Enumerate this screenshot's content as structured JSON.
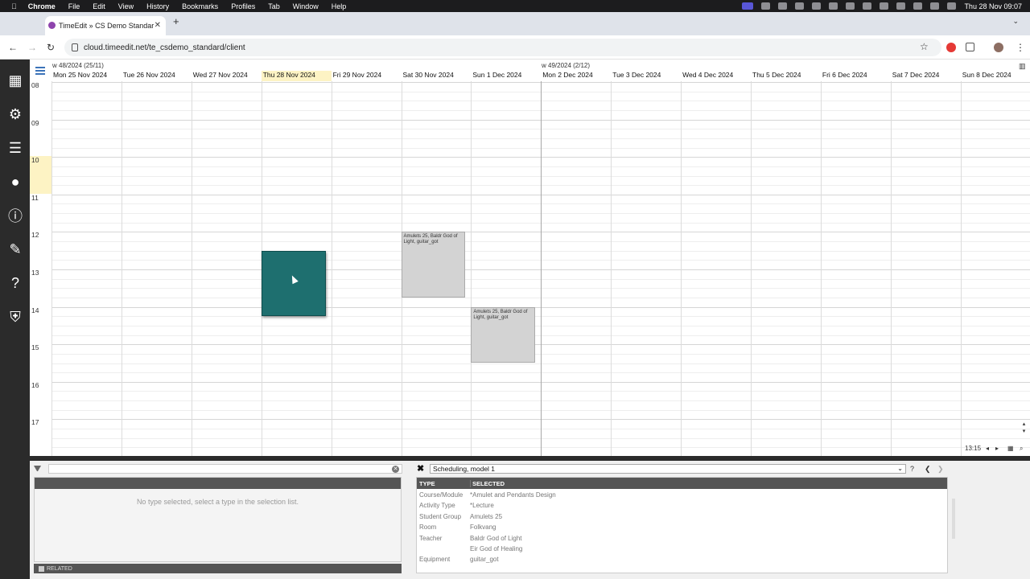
{
  "macos": {
    "app": "Chrome",
    "menus": [
      "File",
      "Edit",
      "View",
      "History",
      "Bookmarks",
      "Profiles",
      "Tab",
      "Window",
      "Help"
    ],
    "clock": "Thu 28 Nov  09:07"
  },
  "browser": {
    "tab_title": "TimeEdit » CS Demo Standar",
    "url": "cloud.timeedit.net/te_csdemo_standard/client"
  },
  "calendar": {
    "weeks": [
      {
        "label": "w 48/2024 (25/11)"
      },
      {
        "label": "w 49/2024 (2/12)"
      }
    ],
    "days": [
      "Mon 25 Nov 2024",
      "Tue 26 Nov 2024",
      "Wed 27 Nov 2024",
      "Thu 28 Nov 2024",
      "Fri 29 Nov 2024",
      "Sat 30 Nov 2024",
      "Sun 1 Dec 2024",
      "Mon 2 Dec 2024",
      "Tue 3 Dec 2024",
      "Wed 4 Dec 2024",
      "Thu 5 Dec 2024",
      "Fri 6 Dec 2024",
      "Sat 7 Dec 2024",
      "Sun 8 Dec 2024"
    ],
    "today_index": 3,
    "hours": [
      "08",
      "09",
      "10",
      "11",
      "12",
      "13",
      "14",
      "15",
      "16",
      "17"
    ],
    "current_hour": "10",
    "bookings": [
      {
        "text": "",
        "day": 3,
        "start": "12:30",
        "end": "14:15",
        "selected": true
      },
      {
        "text": "Amulets 25, Baldr God of Light, guitar_got",
        "day": 5,
        "start": "12:00",
        "end": "13:45",
        "selected": false
      },
      {
        "text": "Amulets 25, Baldr God of Light, guitar_got",
        "day": 6,
        "start": "14:00",
        "end": "15:30",
        "selected": false
      }
    ],
    "time_readout": "13:15"
  },
  "selection_panel": {
    "empty_message": "No type selected, select a type in the selection list.",
    "related_label": "RELATED"
  },
  "model_panel": {
    "model_select": "Scheduling, model 1",
    "col_type": "TYPE",
    "col_selected": "SELECTED",
    "rows": [
      {
        "type": "Course/Module",
        "value": "*Amulet and Pendants Design"
      },
      {
        "type": "Activity Type",
        "value": "*Lecture"
      },
      {
        "type": "Student Group",
        "value": "Amulets 25"
      },
      {
        "type": "Room",
        "value": "Folkvang"
      },
      {
        "type": "Teacher",
        "value": "Baldr God of Light"
      },
      {
        "type": "",
        "value": "Eir God of Healing"
      },
      {
        "type": "Equipment",
        "value": "guitar_got"
      }
    ]
  }
}
